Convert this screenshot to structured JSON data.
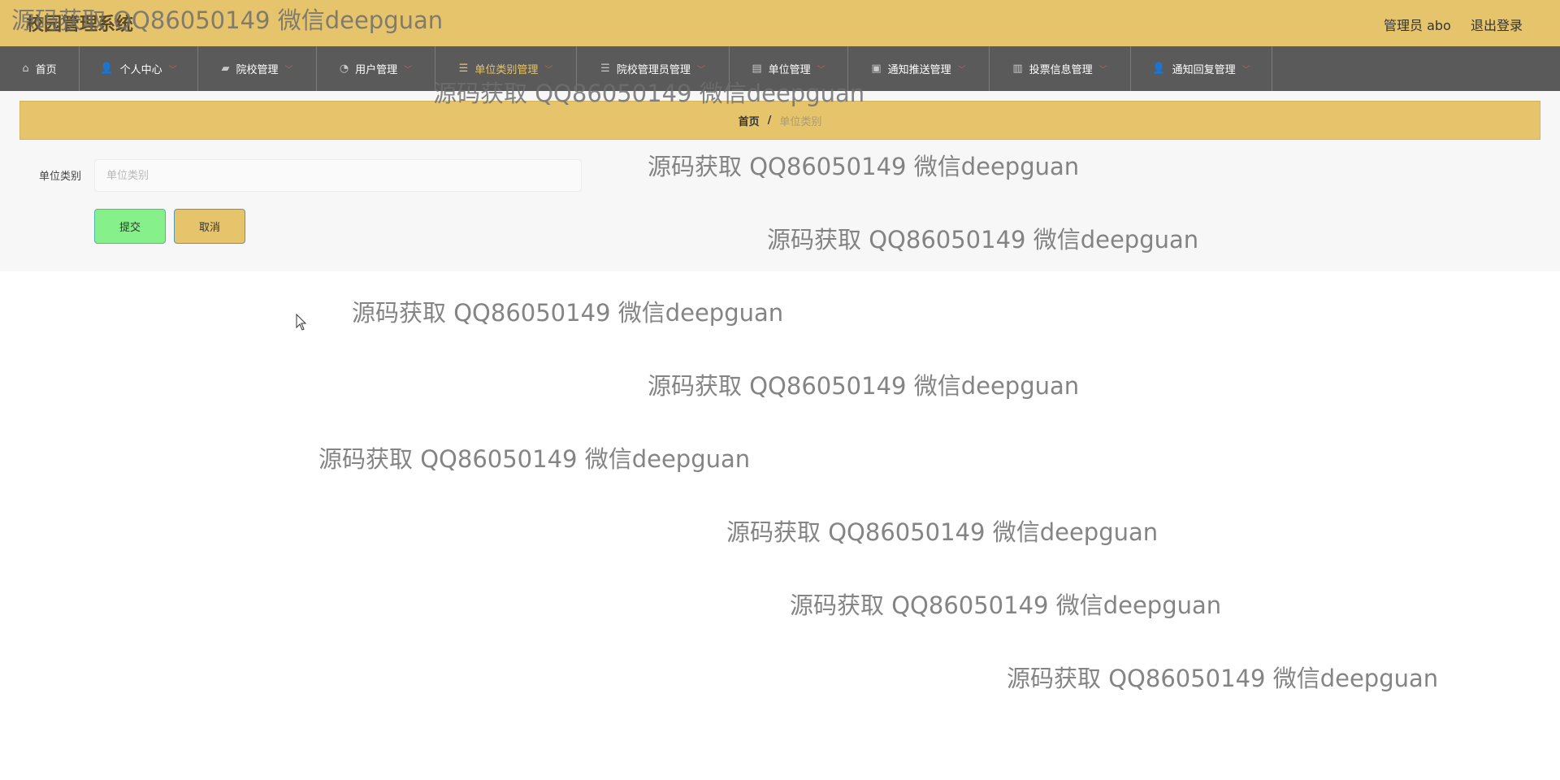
{
  "header": {
    "app_title": "校园管理系统",
    "user_name": "管理员 abo",
    "logout_label": "退出登录"
  },
  "nav": {
    "items": [
      {
        "label": "首页",
        "icon": "home-icon",
        "has_dropdown": false,
        "active": false
      },
      {
        "label": "个人中心",
        "icon": "user-icon",
        "has_dropdown": true,
        "active": false
      },
      {
        "label": "院校管理",
        "icon": "ticket-icon",
        "has_dropdown": true,
        "active": false
      },
      {
        "label": "用户管理",
        "icon": "dashboard-icon",
        "has_dropdown": true,
        "active": false
      },
      {
        "label": "单位类别管理",
        "icon": "list-icon",
        "has_dropdown": true,
        "active": true
      },
      {
        "label": "院校管理员管理",
        "icon": "list-icon",
        "has_dropdown": true,
        "active": false
      },
      {
        "label": "单位管理",
        "icon": "chart-icon",
        "has_dropdown": true,
        "active": false
      },
      {
        "label": "通知推送管理",
        "icon": "briefcase-icon",
        "has_dropdown": true,
        "active": false
      },
      {
        "label": "投票信息管理",
        "icon": "bar-chart-icon",
        "has_dropdown": true,
        "active": false
      },
      {
        "label": "通知回复管理",
        "icon": "user-icon",
        "has_dropdown": true,
        "active": false
      }
    ]
  },
  "breadcrumb": {
    "home": "首页",
    "separator": "/",
    "current": "单位类别"
  },
  "form": {
    "field_label": "单位类别",
    "field_placeholder": "单位类别",
    "field_value": "",
    "submit_label": "提交",
    "cancel_label": "取消"
  },
  "watermark": {
    "text": "源码获取 QQ86050149 微信deepguan"
  },
  "colors": {
    "header_bg": "#e6c46b",
    "nav_bg": "#5a5a5a",
    "active_nav_text": "#e6c46b",
    "submit_bg": "#86f08a",
    "cancel_bg": "#e6c46b"
  }
}
